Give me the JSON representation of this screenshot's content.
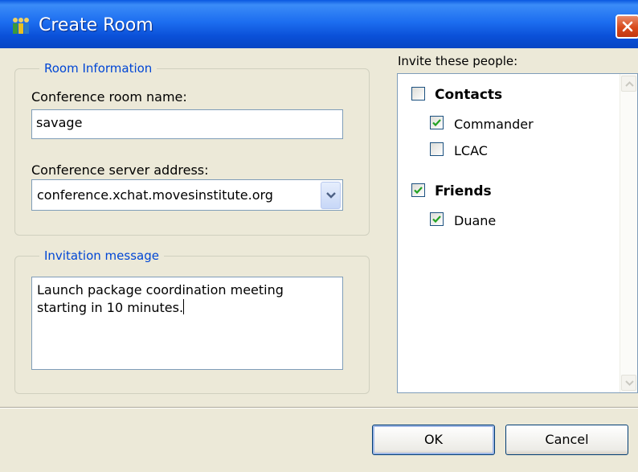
{
  "window": {
    "title": "Create Room",
    "app_icon": "people-icon",
    "close_icon": "close-icon"
  },
  "room_info": {
    "legend": "Room Information",
    "name_label": "Conference room name:",
    "name_value": "savage",
    "server_label": "Conference server address:",
    "server_value": "conference.xchat.movesinstitute.org"
  },
  "invitation": {
    "legend": "Invitation message",
    "lines": [
      "Launch package coordination meeting",
      "starting in 10 minutes."
    ]
  },
  "invite": {
    "label": "Invite these people:",
    "groups": [
      {
        "label": "Contacts",
        "checked": false,
        "members": [
          {
            "label": "Commander",
            "checked": true
          },
          {
            "label": "LCAC",
            "checked": false
          }
        ]
      },
      {
        "label": "Friends",
        "checked": true,
        "members": [
          {
            "label": "Duane",
            "checked": true
          }
        ]
      }
    ]
  },
  "buttons": {
    "ok": "OK",
    "cancel": "Cancel"
  },
  "colors": {
    "titlebar": "#1d6ef0",
    "group_legend": "#0046d5",
    "close_button": "#d84a1c"
  }
}
